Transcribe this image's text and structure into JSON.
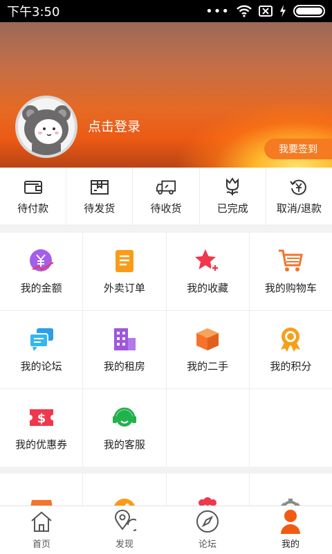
{
  "status_bar": {
    "time": "下午3:50",
    "dots": "•••"
  },
  "header": {
    "login_text": "点击登录",
    "checkin_label": "我要签到"
  },
  "orders": [
    {
      "label": "待付款",
      "icon": "wallet-icon"
    },
    {
      "label": "待发货",
      "icon": "package-icon"
    },
    {
      "label": "待收货",
      "icon": "truck-icon"
    },
    {
      "label": "已完成",
      "icon": "tulip-icon"
    },
    {
      "label": "取消/退款",
      "icon": "refund-icon"
    }
  ],
  "menu": [
    {
      "label": "我的金额",
      "icon": "yen-coin-icon",
      "color": "#a55ee8"
    },
    {
      "label": "外卖订单",
      "icon": "document-icon",
      "color": "#fb9b18"
    },
    {
      "label": "我的收藏",
      "icon": "star-plus-icon",
      "color": "#f0374b"
    },
    {
      "label": "我的购物车",
      "icon": "shopping-cart-icon",
      "color": "#f5732a"
    },
    {
      "label": "我的论坛",
      "icon": "chat-bubbles-icon",
      "color": "#2a9ee8"
    },
    {
      "label": "我的租房",
      "icon": "building-icon",
      "color": "#9c57e0"
    },
    {
      "label": "我的二手",
      "icon": "box-icon",
      "color": "#f5732a"
    },
    {
      "label": "我的积分",
      "icon": "award-ribbon-icon",
      "color": "#f5a017"
    },
    {
      "label": "我的优惠券",
      "icon": "dollar-ticket-icon",
      "color": "#f0374b"
    },
    {
      "label": "我的客服",
      "icon": "headset-icon",
      "color": "#22b24c"
    }
  ],
  "tabs": [
    {
      "label": "首页",
      "icon": "home-icon",
      "active": false
    },
    {
      "label": "发现",
      "icon": "location-pin-icon",
      "active": false
    },
    {
      "label": "论坛",
      "icon": "compass-icon",
      "active": false
    },
    {
      "label": "我的",
      "icon": "person-icon",
      "active": true
    }
  ],
  "colors": {
    "accent": "#f57b22",
    "checkin_bg": "#f57b22",
    "active_tab": "#f25a14"
  }
}
